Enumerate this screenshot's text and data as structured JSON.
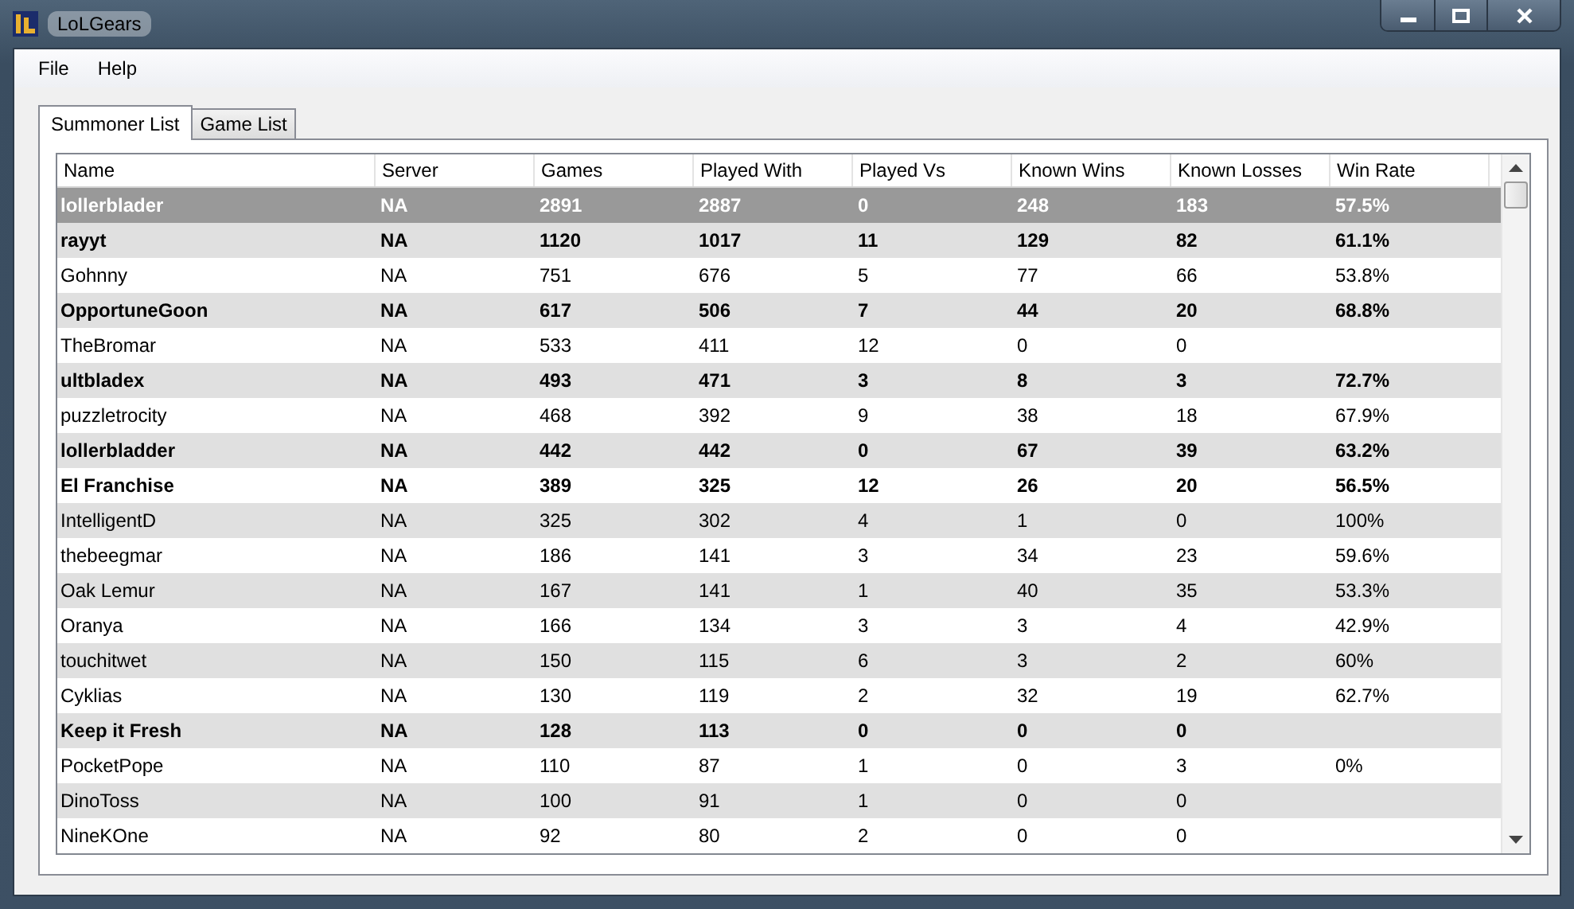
{
  "window": {
    "title": "LoLGears"
  },
  "menu": [
    "File",
    "Help"
  ],
  "tabs": [
    {
      "label": "Summoner List",
      "selected": true
    },
    {
      "label": "Game List",
      "selected": false
    }
  ],
  "table": {
    "columns": [
      "Name",
      "Server",
      "Games",
      "Played With",
      "Played Vs",
      "Known Wins",
      "Known Losses",
      "Win Rate"
    ],
    "rows": [
      {
        "bold": true,
        "selected": true,
        "cells": [
          "lollerblader",
          "NA",
          "2891",
          "2887",
          "0",
          "248",
          "183",
          "57.5%"
        ]
      },
      {
        "bold": true,
        "selected": false,
        "cells": [
          "rayyt",
          "NA",
          "1120",
          "1017",
          "11",
          "129",
          "82",
          "61.1%"
        ]
      },
      {
        "bold": false,
        "selected": false,
        "cells": [
          "Gohnny",
          "NA",
          "751",
          "676",
          "5",
          "77",
          "66",
          "53.8%"
        ]
      },
      {
        "bold": true,
        "selected": false,
        "cells": [
          "OpportuneGoon",
          "NA",
          "617",
          "506",
          "7",
          "44",
          "20",
          "68.8%"
        ]
      },
      {
        "bold": false,
        "selected": false,
        "cells": [
          "TheBromar",
          "NA",
          "533",
          "411",
          "12",
          "0",
          "0"
        ]
      },
      {
        "bold": true,
        "selected": false,
        "cells": [
          "ultbladex",
          "NA",
          "493",
          "471",
          "3",
          "8",
          "3",
          "72.7%"
        ]
      },
      {
        "bold": false,
        "selected": false,
        "cells": [
          "puzzletrocity",
          "NA",
          "468",
          "392",
          "9",
          "38",
          "18",
          "67.9%"
        ]
      },
      {
        "bold": true,
        "selected": false,
        "cells": [
          "lollerbladder",
          "NA",
          "442",
          "442",
          "0",
          "67",
          "39",
          "63.2%"
        ]
      },
      {
        "bold": true,
        "selected": false,
        "cells": [
          "El Franchise",
          "NA",
          "389",
          "325",
          "12",
          "26",
          "20",
          "56.5%"
        ]
      },
      {
        "bold": false,
        "selected": false,
        "cells": [
          "IntelligentD",
          "NA",
          "325",
          "302",
          "4",
          "1",
          "0",
          "100%"
        ]
      },
      {
        "bold": false,
        "selected": false,
        "cells": [
          "thebeegmar",
          "NA",
          "186",
          "141",
          "3",
          "34",
          "23",
          "59.6%"
        ]
      },
      {
        "bold": false,
        "selected": false,
        "cells": [
          "Oak Lemur",
          "NA",
          "167",
          "141",
          "1",
          "40",
          "35",
          "53.3%"
        ]
      },
      {
        "bold": false,
        "selected": false,
        "cells": [
          "Oranya",
          "NA",
          "166",
          "134",
          "3",
          "3",
          "4",
          "42.9%"
        ]
      },
      {
        "bold": false,
        "selected": false,
        "cells": [
          "touchitwet",
          "NA",
          "150",
          "115",
          "6",
          "3",
          "2",
          "60%"
        ]
      },
      {
        "bold": false,
        "selected": false,
        "cells": [
          "Cyklias",
          "NA",
          "130",
          "119",
          "2",
          "32",
          "19",
          "62.7%"
        ]
      },
      {
        "bold": true,
        "selected": false,
        "cells": [
          "Keep it Fresh",
          "NA",
          "128",
          "113",
          "0",
          "0",
          "0"
        ]
      },
      {
        "bold": false,
        "selected": false,
        "cells": [
          "PocketPope",
          "NA",
          "110",
          "87",
          "1",
          "0",
          "3",
          "0%"
        ]
      },
      {
        "bold": false,
        "selected": false,
        "cells": [
          "DinoToss",
          "NA",
          "100",
          "91",
          "1",
          "0",
          "0"
        ]
      },
      {
        "bold": false,
        "selected": false,
        "cells": [
          "NineKOne",
          "NA",
          "92",
          "80",
          "2",
          "0",
          "0"
        ]
      }
    ]
  }
}
